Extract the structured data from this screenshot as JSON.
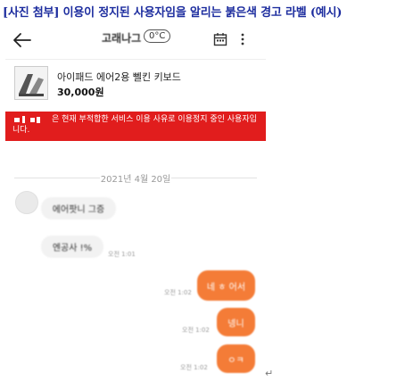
{
  "caption": "[사진 첨부] 이용이 정지된 사용자임을 알리는 붉은색 경고 라벨 (예시)",
  "header": {
    "nickname": "고래나그",
    "temperature": "0°C",
    "icons": [
      "back-arrow-icon",
      "calendar-icon",
      "more-vertical-icon"
    ]
  },
  "product": {
    "title": "아이패드 에어2용 뻴킨 키보드",
    "price": "30,000원"
  },
  "warning": {
    "text": "은 현재 부적합한 서비스 이용 사유로 이용정지 중인 사용자입니다.",
    "background": "#e11d1d"
  },
  "chat": {
    "date": "2021년 4월 20일",
    "incoming": [
      {
        "text": "에어팟니 그증"
      },
      {
        "text": "엔공사 !%"
      }
    ],
    "incoming_time": "오전 1:01",
    "outgoing": [
      {
        "text": "네 ㅎ 어서",
        "time": "오전 1:02"
      },
      {
        "text": "넹니",
        "time": "오전 1:02"
      },
      {
        "text": "ㅇㅋ",
        "time": "오전 1:02"
      }
    ]
  },
  "colors": {
    "caption": "#1d2d9f",
    "outgoing_bubble": "#f47c37",
    "incoming_bubble": "#f2f2f2"
  },
  "return_mark": "↵"
}
